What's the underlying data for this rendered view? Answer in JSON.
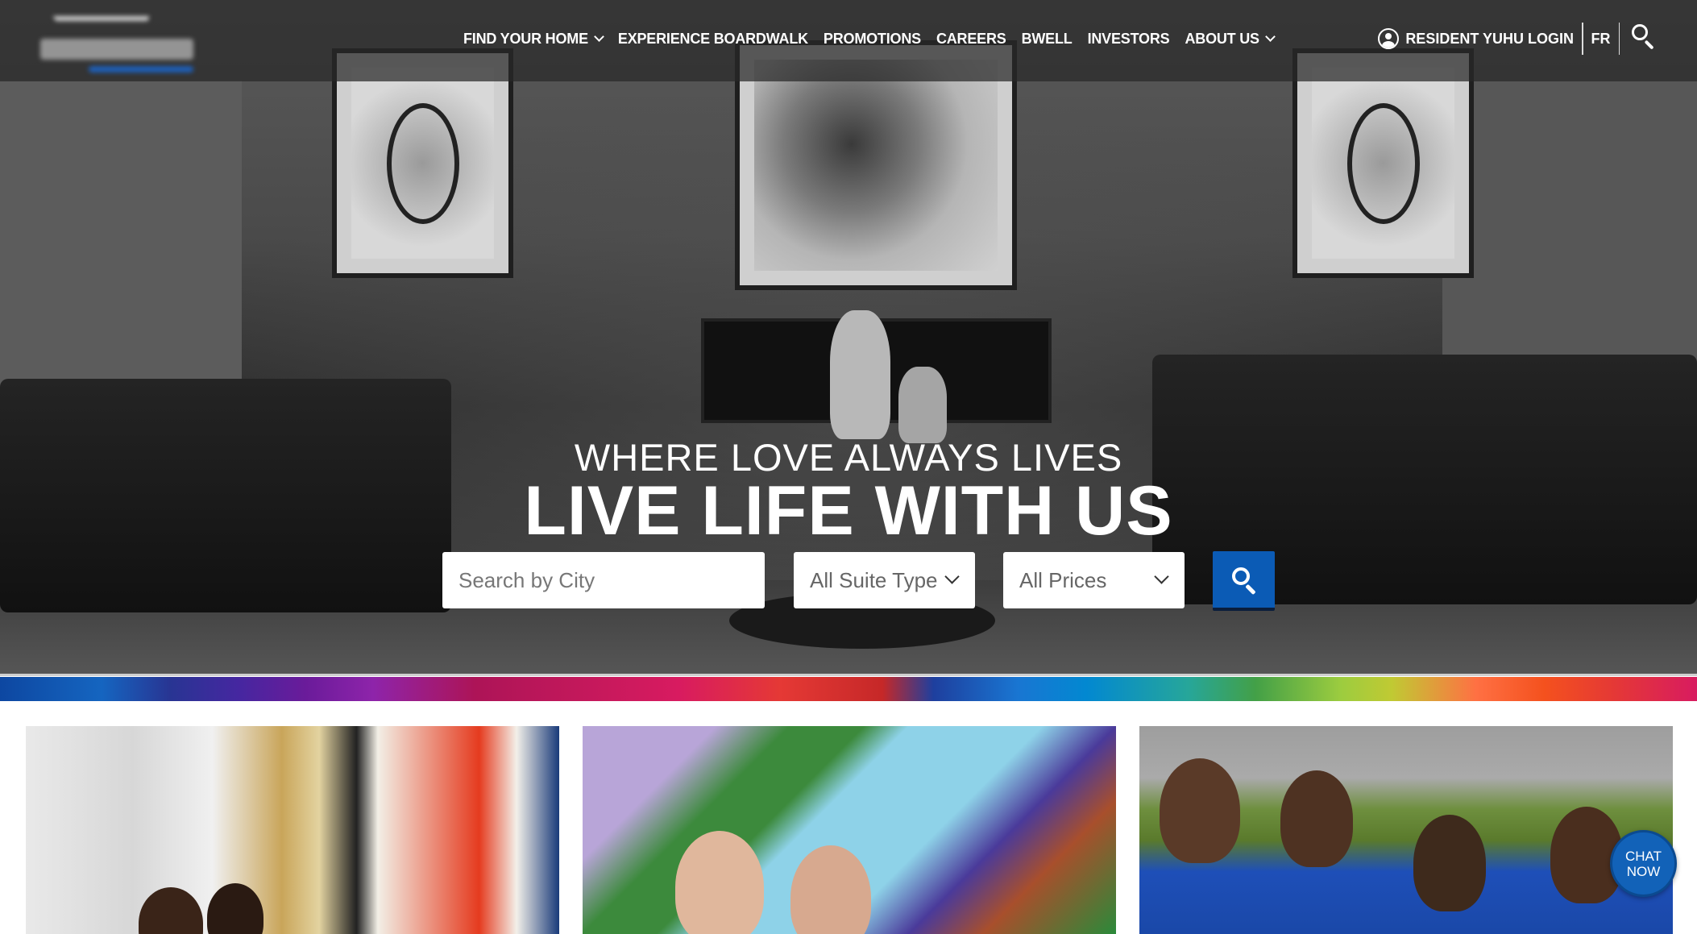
{
  "nav": {
    "items": [
      {
        "label": "FIND YOUR HOME",
        "has_dropdown": true
      },
      {
        "label": "EXPERIENCE BOARDWALK",
        "has_dropdown": false
      },
      {
        "label": "PROMOTIONS",
        "has_dropdown": false
      },
      {
        "label": "CAREERS",
        "has_dropdown": false
      },
      {
        "label": "BWELL",
        "has_dropdown": false
      },
      {
        "label": "INVESTORS",
        "has_dropdown": false
      },
      {
        "label": "ABOUT US",
        "has_dropdown": true
      }
    ],
    "login_label": "RESIDENT YUHU LOGIN",
    "language_label": "FR",
    "user_icon": "user-circle-icon",
    "search_icon": "search-icon"
  },
  "hero": {
    "tagline": "WHERE LOVE ALWAYS LIVES",
    "headline": "LIVE LIFE WITH US"
  },
  "search": {
    "city_placeholder": "Search by City",
    "suite_type_selected": "All Suite Type",
    "prices_selected": "All Prices",
    "submit_icon": "search-icon"
  },
  "chat": {
    "line1": "CHAT",
    "line2": "NOW"
  },
  "colors": {
    "nav_bg": "#282828",
    "search_button": "#0b5bb5",
    "chat_button": "#1262b8"
  }
}
